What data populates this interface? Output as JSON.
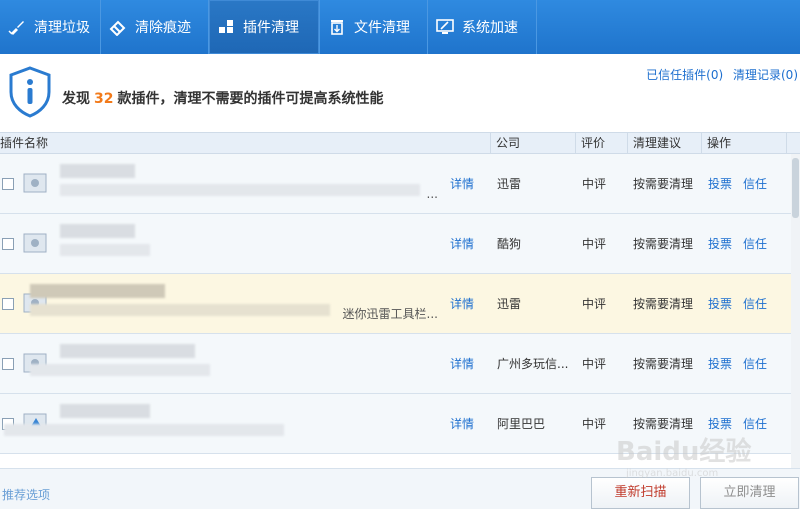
{
  "tabs": [
    {
      "label": "清理垃圾",
      "icon": "broom-icon",
      "active": false
    },
    {
      "label": "清除痕迹",
      "icon": "eraser-icon",
      "active": false
    },
    {
      "label": "插件清理",
      "icon": "puzzle-icon",
      "active": true
    },
    {
      "label": "文件清理",
      "icon": "trash-icon",
      "active": false
    },
    {
      "label": "系统加速",
      "icon": "monitor-speed-icon",
      "active": false
    }
  ],
  "header": {
    "found_prefix": "发现",
    "plugin_count": "32",
    "found_suffix": "款插件，清理不需要的插件可提高系统性能",
    "trusted_link": "已信任插件(0)",
    "history_link": "清理记录(0)"
  },
  "table": {
    "columns": {
      "name": "插件名称",
      "company": "公司",
      "rating": "评价",
      "advice": "清理建议",
      "action": "操作"
    },
    "rows": [
      {
        "description": "...",
        "detail": "详情",
        "company": "迅雷",
        "rating": "中评",
        "advice": "按需要清理",
        "vote": "投票",
        "trust": "信任"
      },
      {
        "description": "",
        "detail": "详情",
        "company": "酷狗",
        "rating": "中评",
        "advice": "按需要清理",
        "vote": "投票",
        "trust": "信任"
      },
      {
        "description": "迷你迅雷工具栏...",
        "detail": "详情",
        "company": "迅雷",
        "rating": "中评",
        "advice": "按需要清理",
        "vote": "投票",
        "trust": "信任"
      },
      {
        "description": "",
        "detail": "详情",
        "company": "广州多玩信...",
        "rating": "中评",
        "advice": "按需要清理",
        "vote": "投票",
        "trust": "信任"
      },
      {
        "description": "",
        "detail": "详情",
        "company": "阿里巴巴",
        "rating": "中评",
        "advice": "按需要清理",
        "vote": "投票",
        "trust": "信任"
      }
    ]
  },
  "footer": {
    "recommend_link": "推荐选项",
    "rescan_button": "重新扫描",
    "clean_button": "立即清理"
  },
  "watermark": {
    "text": "Baidu经验",
    "sub": "jingyan.baidu.com"
  },
  "colors": {
    "tabbar": "#1f74cc",
    "link": "#1d6fcf",
    "count": "#f27a1a",
    "highlight_row": "#fcf7e2"
  }
}
